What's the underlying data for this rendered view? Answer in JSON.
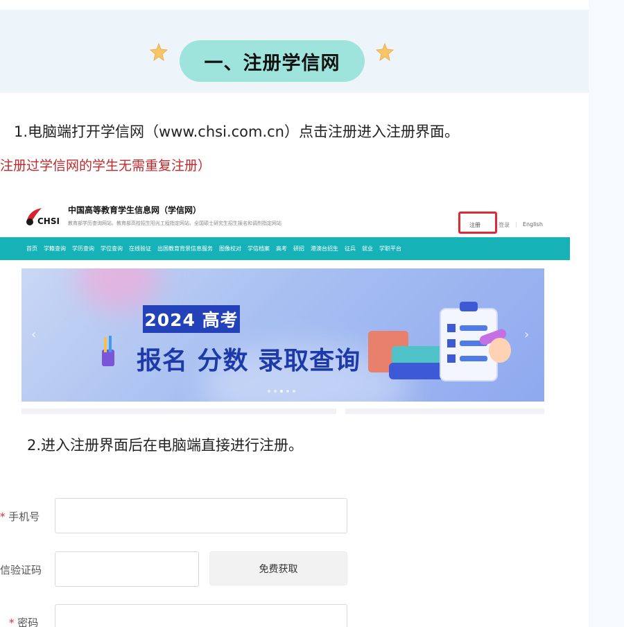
{
  "section": {
    "title": "一、注册学信网"
  },
  "steps": {
    "step1": "1.电脑端打开学信网（www.chsi.com.cn）点击注册进入注册界面。",
    "note": "注册过学信网的学生无需重复注册）",
    "step2": "2.进入注册界面后在电脑端直接进行注册。"
  },
  "chsi": {
    "brand": "CHSI",
    "title": "中国高等教育学生信息网（学信网）",
    "subtitle": "教育部学历查询网站、教育部高校招生阳光工程指定网站、全国硕士研究生招生报名和调剂指定网站",
    "register": "注册",
    "login": "登录",
    "separator": "|",
    "english": "English",
    "nav": [
      "首页",
      "学籍查询",
      "学历查询",
      "学位查询",
      "在线验证",
      "出国教育背景信息服务",
      "图像校对",
      "学信档案",
      "高考",
      "研招",
      "港澳台招生",
      "征兵",
      "就业",
      "学职平台"
    ],
    "banner": {
      "year_tag": "2024 高考",
      "headline": "报名 分数 录取查询",
      "arrow_left": "‹",
      "arrow_right": "›"
    },
    "colors": {
      "nav": "#16b2b7",
      "highlight": "#e02a33",
      "banner_text": "#1d3aa8"
    }
  },
  "form": {
    "phone_label": "手机号",
    "code_label": "信验证码",
    "code_button": "免费获取",
    "password_label": "密码",
    "required_mark": "*"
  },
  "colors": {
    "pill": "#9ee3dc",
    "star": "#f6c56b",
    "note": "#c0282d"
  }
}
